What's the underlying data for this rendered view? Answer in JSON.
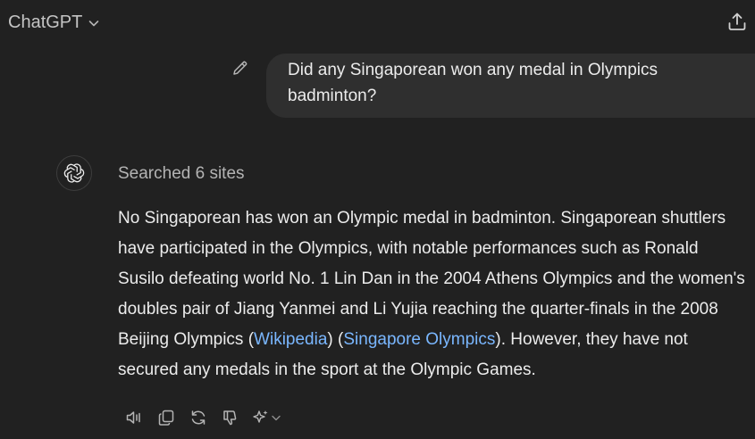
{
  "header": {
    "model_name": "ChatGPT",
    "model_icon": "chevron-down-icon",
    "share_icon": "share-icon"
  },
  "conversation": {
    "user_message": "Did any Singaporean won any medal in Olympics badminton?",
    "edit_icon": "pencil-icon",
    "assistant": {
      "avatar_icon": "openai-logo-icon",
      "search_status": "Searched 6 sites",
      "answer": {
        "part1": "No Singaporean has won an Olympic medal in badminton. Singaporean shuttlers have participated in the Olympics, with notable performances such as Ronald Susilo defeating world No. 1 Lin Dan in the 2004 Athens Olympics and the women's doubles pair of Jiang Yanmei and Li Yujia reaching the quarter-finals in the 2008 Beijing Olympics (",
        "link1": "Wikipedia",
        "mid": ") (",
        "link2": "Singapore Olympics",
        "part2": "). However, they have not secured any medals in the sport at the Olympic Games."
      },
      "actions": [
        "read-aloud-icon",
        "copy-icon",
        "regenerate-icon",
        "thumbs-down-icon",
        "sparkle-icon"
      ]
    }
  },
  "colors": {
    "background": "#212121",
    "bubble": "#2f2f2f",
    "link": "#7ab7ff",
    "muted": "#b4b4b4"
  }
}
